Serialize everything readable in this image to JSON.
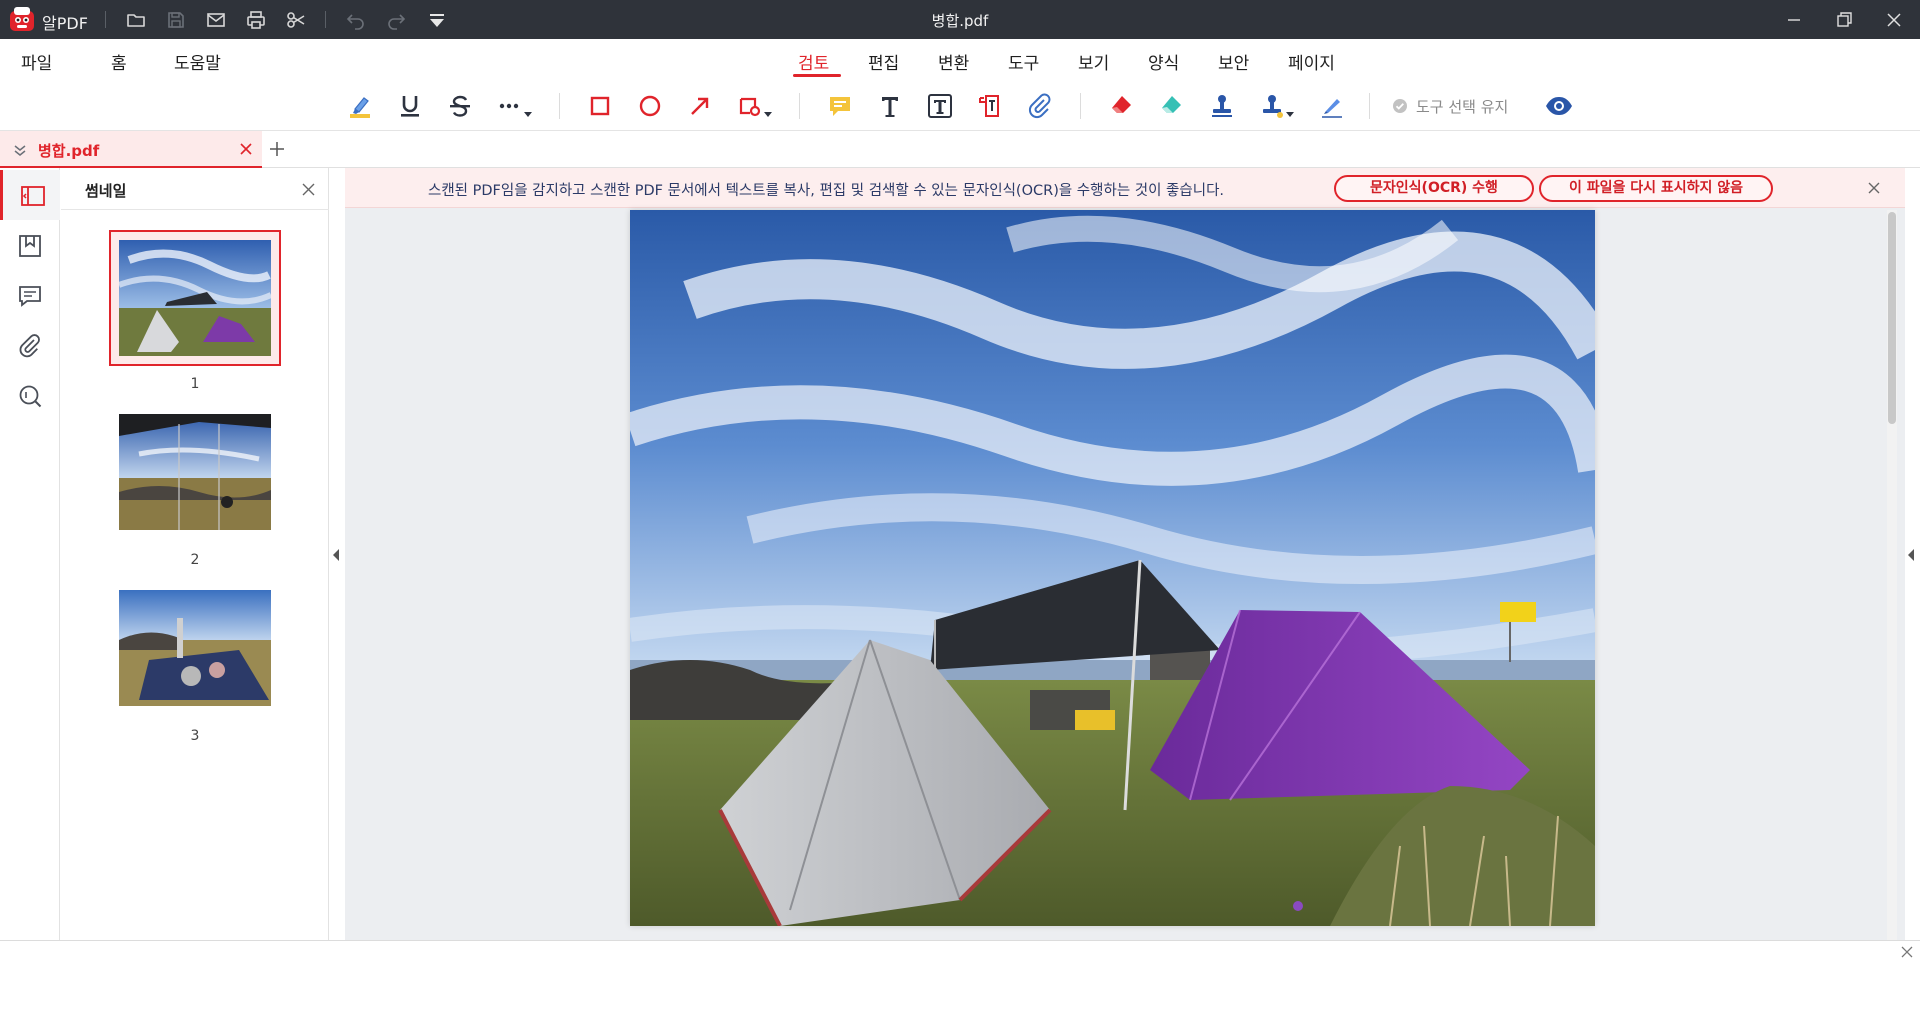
{
  "app": {
    "name": "알PDF",
    "window_title": "병합.pdf"
  },
  "menu": {
    "file": "파일",
    "home": "홈",
    "help": "도움말"
  },
  "ribbon_tabs": [
    "검토",
    "편집",
    "변환",
    "도구",
    "보기",
    "양식",
    "보안",
    "페이지"
  ],
  "active_ribbon_tab": "검토",
  "toolbar": {
    "keep_tool_label": "도구 선택 유지"
  },
  "document_tab": {
    "name": "병합.pdf"
  },
  "thumbnail_panel": {
    "title": "썸네일",
    "pages": [
      "1",
      "2",
      "3"
    ]
  },
  "ocr_notice": {
    "message": "스캔된 PDF임을 감지하고 스캔한 PDF 문서에서 텍스트를 복사, 편집 및 검색할 수 있는 문자인식(OCR)을 수행하는 것이 좋습니다.",
    "ocr_button": "문자인식(OCR) 수행",
    "dont_show_button": "이 파일을 다시 표시하지 않음"
  },
  "colors": {
    "accent": "#e0242b",
    "titlebar": "#2f333a",
    "notice_bg": "#fdeeee"
  }
}
